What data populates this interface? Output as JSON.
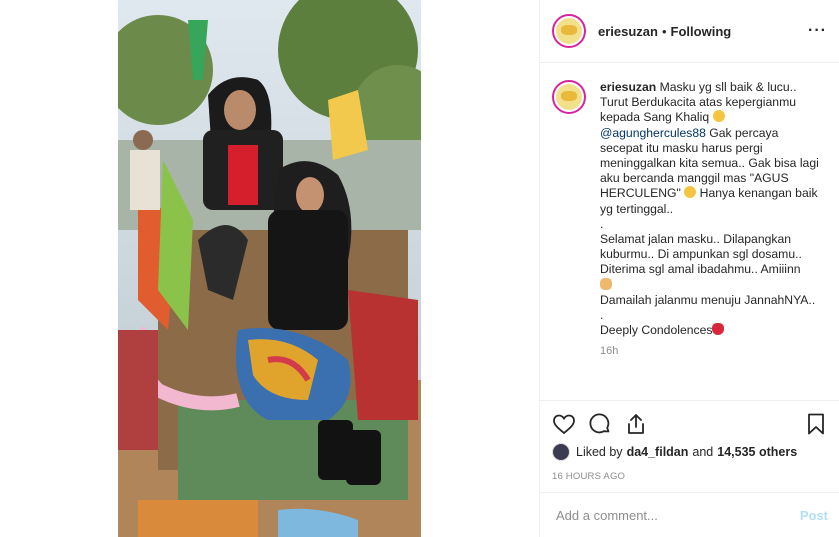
{
  "post": {
    "username": "eriesuzan",
    "follow_status": "Following",
    "dot": "•",
    "more_label": "···"
  },
  "caption": {
    "username": "eriesuzan",
    "line1": "Masku yg sll baik & lucu.. Turut Berdukacita atas kepergianmu kepada Sang Khaliq",
    "mention": "@agunghercules88",
    "line2": " Gak percaya secepat itu masku harus pergi meninggalkan kita semua.. Gak bisa lagi aku bercanda manggil mas \"AGUS HERCULENG\"",
    "line3": " Hanya kenangan baik yg tertinggal..",
    "dot_line": ".",
    "para2": "Selamat jalan masku.. Dilapangkan kuburmu.. Di ampunkan sgl dosamu.. Diterima sgl amal ibadahmu.. Amiiinn",
    "para3": "Damailah jalanmu menuju JannahNYA..",
    "dot_line2": ".",
    "para4": "Deeply Condolences",
    "time": "16h"
  },
  "likes": {
    "prefix": "Liked by",
    "user": "da4_fildan",
    "and": "and",
    "count": "14,535 others"
  },
  "timestamp": "16 HOURS AGO",
  "comment": {
    "placeholder": "Add a comment...",
    "post_label": "Post"
  },
  "icons": {
    "like": "heart-icon",
    "comment": "comment-icon",
    "share": "share-icon",
    "save": "bookmark-icon"
  },
  "colors": {
    "link": "#003569",
    "post_disabled": "#b2dffc",
    "secondary": "#8e8e8e"
  }
}
